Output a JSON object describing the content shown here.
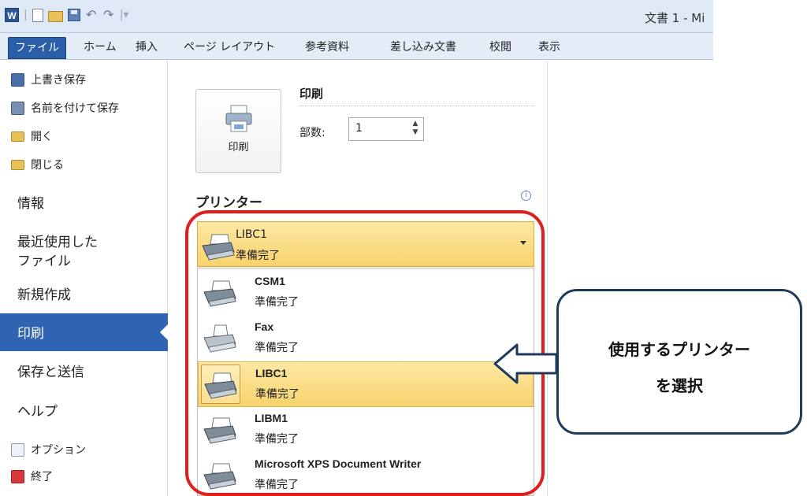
{
  "window": {
    "title": "文書 1 - Mi"
  },
  "ribbon": {
    "tabs": [
      "ファイル",
      "ホーム",
      "挿入",
      "ページ レイアウト",
      "参考資料",
      "差し込み文書",
      "校閲",
      "表示"
    ]
  },
  "nav": {
    "small_items": [
      "上書き保存",
      "名前を付けて保存",
      "開く",
      "閉じる"
    ],
    "info": "情報",
    "recent_line1": "最近使用した",
    "recent_line2": "ファイル",
    "new": "新規作成",
    "print": "印刷",
    "save_send": "保存と送信",
    "help": "ヘルプ",
    "options": "オプション",
    "exit": "終了"
  },
  "print": {
    "button_label": "印刷",
    "heading": "印刷",
    "copies_label": "部数:",
    "copies_value": "1"
  },
  "printer": {
    "heading": "プリンター",
    "selected_name": "LIBC1",
    "selected_status": "準備完了",
    "list": [
      {
        "name": "CSM1",
        "status": "準備完了"
      },
      {
        "name": "Fax",
        "status": "準備完了"
      },
      {
        "name": "LIBC1",
        "status": "準備完了"
      },
      {
        "name": "LIBM1",
        "status": "準備完了"
      },
      {
        "name": "Microsoft XPS Document Writer",
        "status": "準備完了"
      }
    ]
  },
  "callout": {
    "line1": "使用するプリンター",
    "line2": "を選択"
  },
  "colors": {
    "file_tab": "#2b5ea8",
    "nav_selected": "#2e64b1",
    "selection": "#f8d36d",
    "highlight_frame": "#e21d1d",
    "callout_border": "#1f3a5a"
  }
}
